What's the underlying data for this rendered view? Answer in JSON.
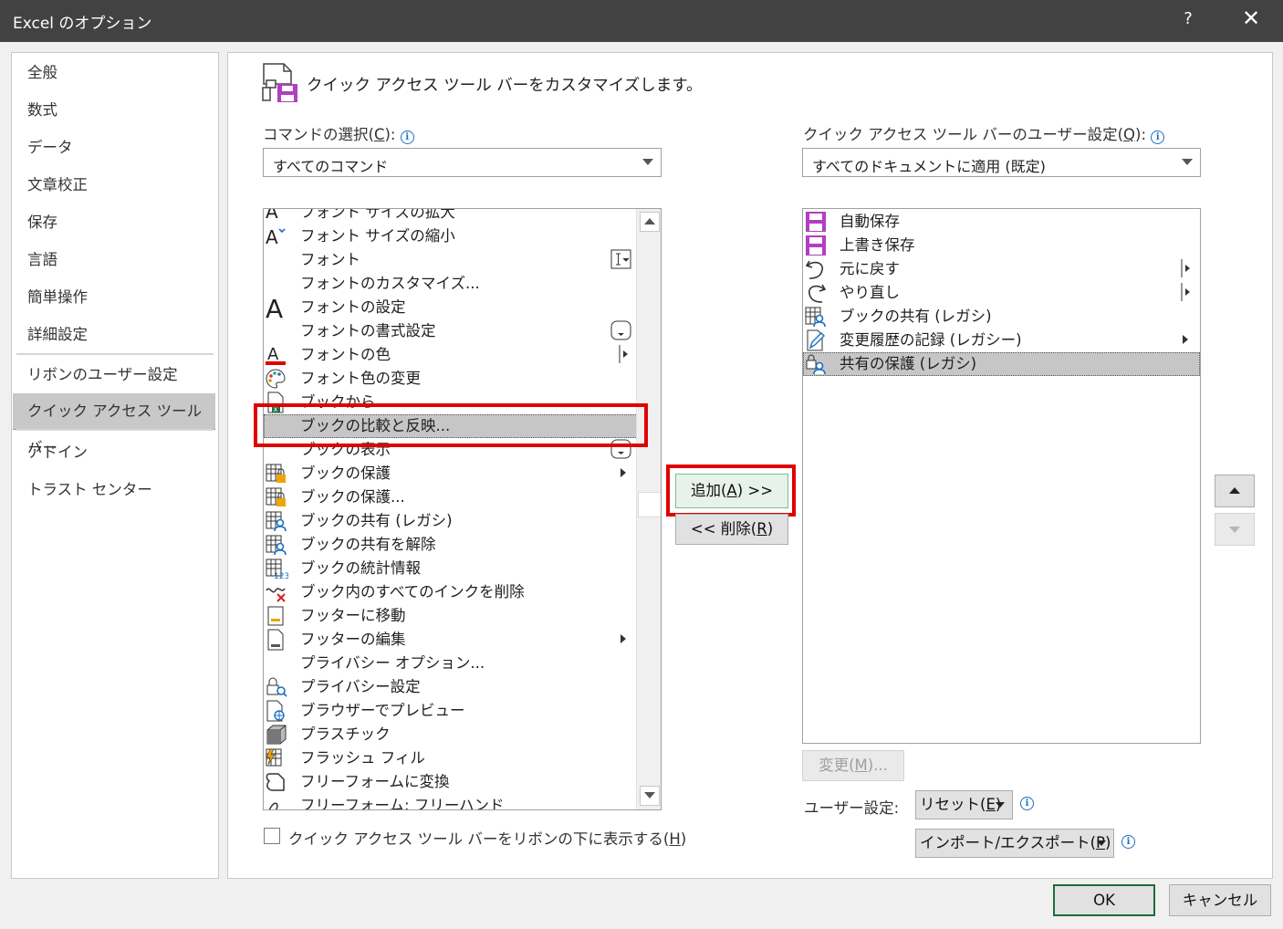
{
  "window": {
    "title": "Excel のオプション",
    "help_glyph": "?",
    "close_glyph": "✕"
  },
  "nav": {
    "items": [
      {
        "label": "全般"
      },
      {
        "label": "数式"
      },
      {
        "label": "データ"
      },
      {
        "label": "文章校正"
      },
      {
        "label": "保存"
      },
      {
        "label": "言語"
      },
      {
        "label": "簡単操作"
      },
      {
        "label": "詳細設定"
      },
      {
        "label": "リボンのユーザー設定"
      },
      {
        "label": "クイック アクセス ツール バー",
        "selected": true
      },
      {
        "label": "アドイン"
      },
      {
        "label": "トラスト センター"
      }
    ]
  },
  "header": {
    "text": "クイック アクセス ツール バーをカスタマイズします。"
  },
  "commands": {
    "label_prefix": "コマンドの選択(",
    "label_key": "C",
    "label_suffix": "):",
    "combo_value": "すべてのコマンド",
    "items": [
      {
        "label": "フォント サイズの拡大",
        "icon": "font-grow-icon"
      },
      {
        "label": "フォント サイズの縮小",
        "icon": "font-shrink-icon"
      },
      {
        "label": "フォント",
        "icon": "",
        "right": "text-box-icon"
      },
      {
        "label": "フォントのカスタマイズ...",
        "icon": ""
      },
      {
        "label": "フォントの設定",
        "icon": "font-large-icon"
      },
      {
        "label": "フォントの書式設定",
        "icon": "",
        "right": "dropdown-box-icon"
      },
      {
        "label": "フォントの色",
        "icon": "font-color-icon",
        "right": "split-arrow-icon"
      },
      {
        "label": "フォント色の変更",
        "icon": "palette-icon"
      },
      {
        "label": "ブックから",
        "icon": "excel-book-icon"
      },
      {
        "label": "ブックの比較と反映...",
        "icon": "",
        "selected": true
      },
      {
        "label": "ブックの表示",
        "icon": "",
        "right": "dropdown-box-icon"
      },
      {
        "label": "ブックの保護",
        "icon": "book-lock-icon",
        "right": "submenu-arrow-icon"
      },
      {
        "label": "ブックの保護...",
        "icon": "book-lock-icon"
      },
      {
        "label": "ブックの共有 (レガシ)",
        "icon": "book-share-icon"
      },
      {
        "label": "ブックの共有を解除",
        "icon": "book-share-icon"
      },
      {
        "label": "ブックの統計情報",
        "icon": "book-stats-icon"
      },
      {
        "label": "ブック内のすべてのインクを削除",
        "icon": "ink-delete-icon"
      },
      {
        "label": "フッターに移動",
        "icon": "footer-icon"
      },
      {
        "label": "フッターの編集",
        "icon": "footer-edit-icon",
        "right": "submenu-arrow-icon"
      },
      {
        "label": "プライバシー オプション...",
        "icon": ""
      },
      {
        "label": "プライバシー設定",
        "icon": "privacy-lock-icon"
      },
      {
        "label": "ブラウザーでプレビュー",
        "icon": "browser-preview-icon"
      },
      {
        "label": "プラスチック",
        "icon": "plastic-cube-icon"
      },
      {
        "label": "フラッシュ フィル",
        "icon": "flash-fill-icon"
      },
      {
        "label": "フリーフォームに変換",
        "icon": "freeform-convert-icon"
      },
      {
        "label": "フリーフォーム: フリーハンド",
        "icon": "freehand-icon"
      }
    ],
    "checkbox_label_prefix": "クイック アクセス ツール バーをリボンの下に表示する(",
    "checkbox_key": "H",
    "checkbox_label_suffix": ")"
  },
  "middle": {
    "add_prefix": "追加(",
    "add_key": "A",
    "add_suffix": ") >>",
    "remove_prefix": "<< 削除(",
    "remove_key": "R",
    "remove_suffix": ")"
  },
  "qat": {
    "label_prefix": "クイック アクセス ツール バーのユーザー設定(",
    "label_key": "Q",
    "label_suffix": "):",
    "combo_value": "すべてのドキュメントに適用 (既定)",
    "items": [
      {
        "label": "自動保存",
        "icon": "autosave-icon"
      },
      {
        "label": "上書き保存",
        "icon": "save-icon"
      },
      {
        "label": "元に戻す",
        "icon": "undo-icon",
        "right": "split-arrow-icon"
      },
      {
        "label": "やり直し",
        "icon": "redo-icon",
        "right": "split-arrow-icon"
      },
      {
        "label": "ブックの共有 (レガシ)",
        "icon": "book-share-icon"
      },
      {
        "label": "変更履歴の記録 (レガシー)",
        "icon": "track-changes-icon",
        "right": "submenu-arrow-icon"
      },
      {
        "label": "共有の保護 (レガシ)",
        "icon": "protect-share-icon",
        "selected": true
      }
    ],
    "modify_prefix": "変更(",
    "modify_key": "M",
    "modify_suffix": ")...",
    "user_settings_label": "ユーザー設定:",
    "reset_prefix": "リセット(",
    "reset_key": "E",
    "reset_suffix": ")",
    "import_prefix": "インポート/エクスポート(",
    "import_key": "P",
    "import_suffix": ")"
  },
  "footer": {
    "ok": "OK",
    "cancel": "キャンセル"
  },
  "colors": {
    "highlight": "#e00000",
    "ok_border": "#1e6b3c",
    "purple": "#b13fc0"
  }
}
